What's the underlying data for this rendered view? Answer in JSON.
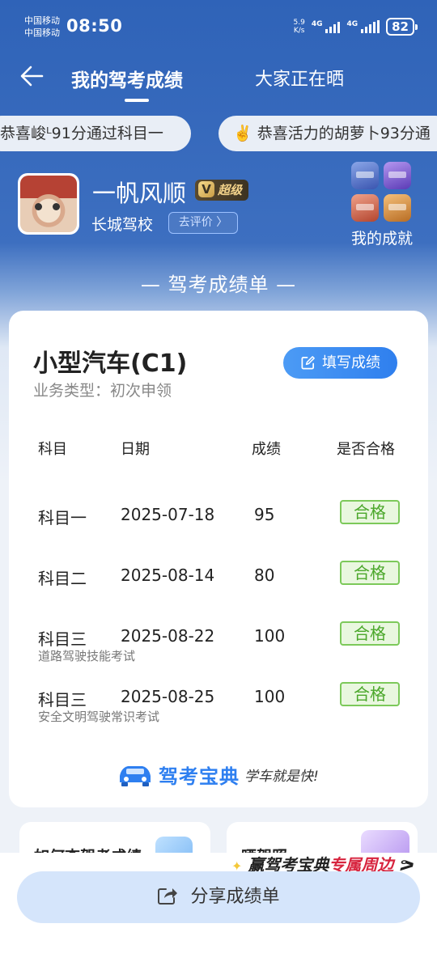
{
  "status_bar": {
    "carrier_1": "中国移动",
    "carrier_2": "中国移动",
    "time": "08:50",
    "net_speed_value": "5.9",
    "net_speed_unit": "K/s",
    "signal_1": "4G",
    "signal_2": "4G",
    "battery": "82"
  },
  "nav": {
    "tab_active": "我的驾考成绩",
    "tab_2": "大家正在晒"
  },
  "marquee": {
    "item_1": "恭喜峻ᴸ91分通过科目一",
    "item_2_emoji": "✌️",
    "item_2": "恭喜活力的胡萝卜93分通"
  },
  "profile": {
    "username": "一帆风顺",
    "vip_label": "超级",
    "school": "长城驾校",
    "rate_button": "去评价 〉",
    "achievements_label": "我的成就"
  },
  "section_title": "— 驾考成绩单 —",
  "card": {
    "car_type": "小型汽车(C1)",
    "business_type": "业务类型：初次申领",
    "fill_button": "填写成绩",
    "headers": [
      "科目",
      "日期",
      "成绩",
      "是否合格"
    ],
    "rows": [
      {
        "subject": "科目一",
        "date": "2025-07-18",
        "score": "95",
        "result": "合格",
        "note": ""
      },
      {
        "subject": "科目二",
        "date": "2025-08-14",
        "score": "80",
        "result": "合格",
        "note": ""
      },
      {
        "subject": "科目三",
        "date": "2025-08-22",
        "score": "100",
        "result": "合格",
        "note": "道路驾驶技能考试"
      },
      {
        "subject": "科目三",
        "date": "2025-08-25",
        "score": "100",
        "result": "合格",
        "note": "安全文明驾驶常识考试"
      }
    ],
    "brand_name": "驾考宝典",
    "brand_slogan": "学车就是快!"
  },
  "bottom": {
    "mini_card_1": "如何查驾考成绩",
    "mini_card_2": "晒驾照",
    "promo_prefix": "赢驾考宝典",
    "promo_highlight": "专属周边",
    "share_button": "分享成绩单"
  },
  "colors": {
    "header_blue": "#2f63b8",
    "accent_blue": "#2f7fee",
    "pass_green": "#4aa72a",
    "promo_red": "#d7243e"
  }
}
